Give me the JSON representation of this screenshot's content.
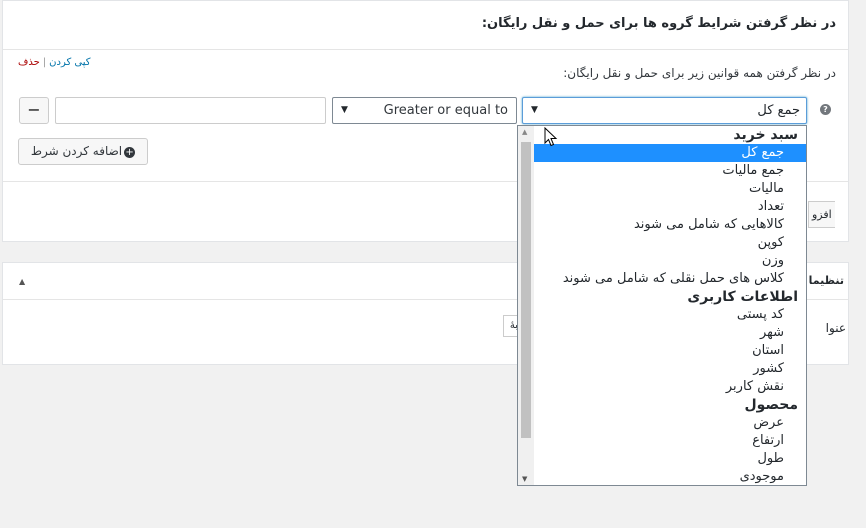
{
  "header": {
    "title": "در نظر گرفتن شرایط گروه ها برای حمل و نقل رایگان:"
  },
  "rule": {
    "subtitle": "در نظر گرفتن همه قوانین زیر برای حمل و نقل رایگان:",
    "copy_link": "کپی کردن",
    "separator": "|",
    "delete_link": "حذف"
  },
  "condition": {
    "field_value": "جمع کل",
    "operator_value": "Greater or equal to",
    "value_input": "",
    "remove_label": "−",
    "help_label": "?"
  },
  "add_condition_label": "اضافه کردن شرط",
  "add_condition_icon": "plus-circle-icon",
  "partial_button_label": "افزو",
  "settings_card": {
    "title": "تنظیما",
    "toggle": "▲",
    "field_label": "عنوا",
    "mini_input_value": "بهٔ"
  },
  "dropdown": {
    "options": [
      {
        "label": "سبد خرید",
        "group": true
      },
      {
        "label": "جمع کل",
        "selected": true
      },
      {
        "label": "جمع مالیات"
      },
      {
        "label": "مالیات"
      },
      {
        "label": "تعداد"
      },
      {
        "label": "کالاهایی که شامل می شوند"
      },
      {
        "label": "کوپن"
      },
      {
        "label": "وزن"
      },
      {
        "label": "کلاس های حمل نقلی که شامل می شوند"
      },
      {
        "label": "اطلاعات کاربری",
        "group": true
      },
      {
        "label": "کد پستی"
      },
      {
        "label": "شهر"
      },
      {
        "label": "استان"
      },
      {
        "label": "کشور"
      },
      {
        "label": "نقش کاربر"
      },
      {
        "label": "محصول",
        "group": true
      },
      {
        "label": "عرض"
      },
      {
        "label": "ارتفاع"
      },
      {
        "label": "طول"
      },
      {
        "label": "موجودی"
      }
    ]
  },
  "colors": {
    "selected_bg": "#1e90ff",
    "link": "#0073aa",
    "delete": "#aa0000"
  }
}
